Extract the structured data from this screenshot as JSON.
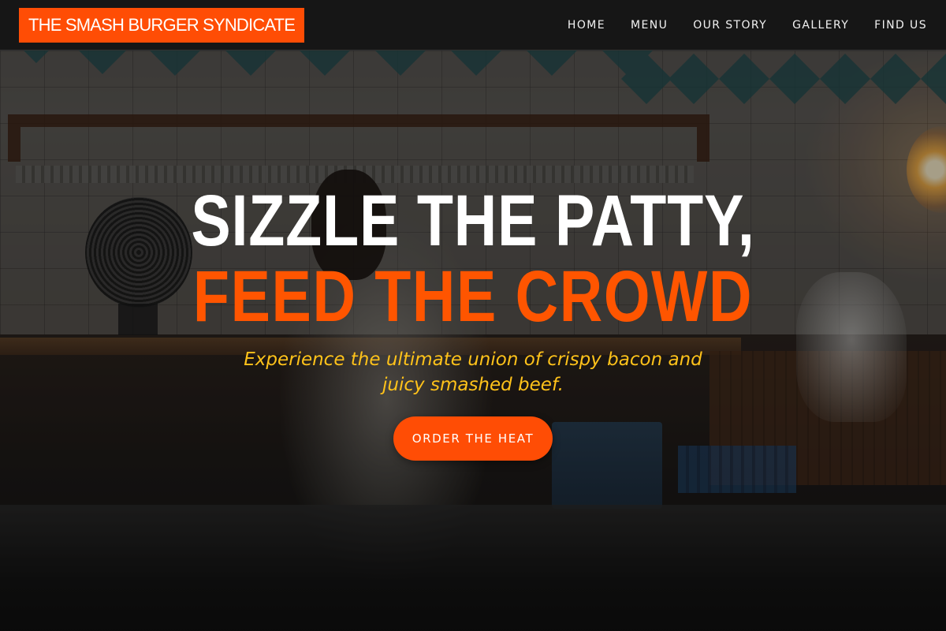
{
  "brand": {
    "name": "THE SMASH BURGER SYNDICATE",
    "accent_color": "#ff4d05"
  },
  "nav": {
    "items": [
      {
        "label": "HOME"
      },
      {
        "label": "MENU"
      },
      {
        "label": "OUR STORY"
      },
      {
        "label": "GALLERY"
      },
      {
        "label": "FIND US"
      }
    ]
  },
  "hero": {
    "headline_line1": "SIZZLE THE PATTY,",
    "headline_line2": "FEED THE CROWD",
    "tagline": "Experience the ultimate union of crispy bacon and juicy smashed beef.",
    "cta_label": "ORDER THE HEAT",
    "colors": {
      "headline_primary": "#ffffff",
      "headline_accent": "#ff5500",
      "tagline": "#ffc21a"
    }
  }
}
